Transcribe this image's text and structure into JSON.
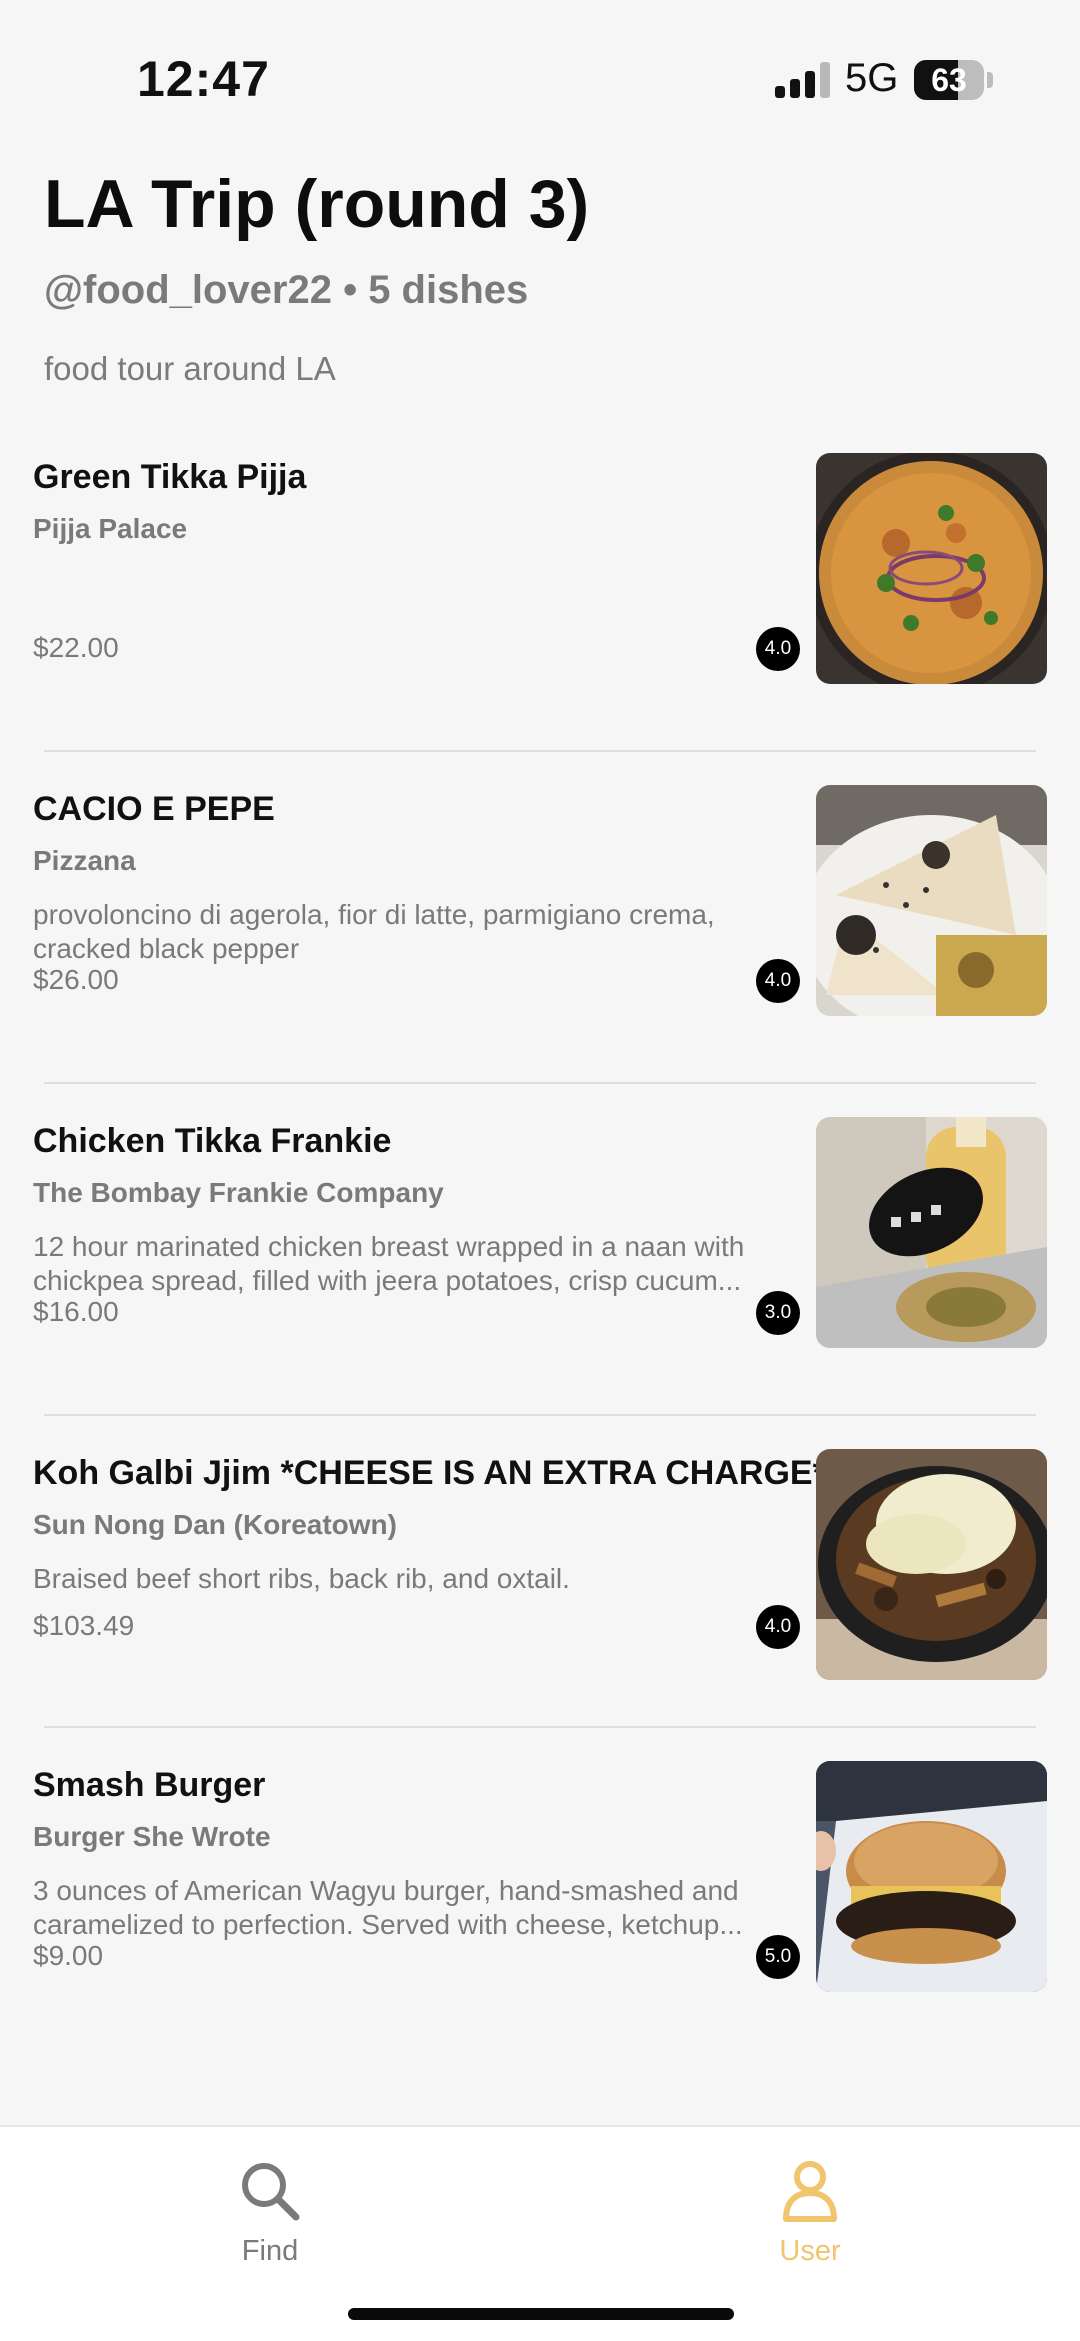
{
  "status_bar": {
    "time": "12:47",
    "network": "5G",
    "battery": "63",
    "battery_level": 0.63
  },
  "header": {
    "title": "LA Trip (round 3)",
    "subtitle": "@food_lover22 • 5 dishes",
    "description": "food tour around LA"
  },
  "dishes": [
    {
      "name": "Green Tikka Pijja",
      "restaurant": "Pijja Palace",
      "description": "",
      "price": "$22.00",
      "rating": "4.0",
      "photo": "pizza-photo"
    },
    {
      "name": "CACIO E PEPE",
      "restaurant": "Pizzana",
      "description": "provoloncino di agerola, fior di latte, parmigiano crema, cracked black pepper",
      "price": "$26.00",
      "rating": "4.0",
      "photo": "cacio-pizza-photo"
    },
    {
      "name": "Chicken Tikka Frankie",
      "restaurant": "The Bombay Frankie Company",
      "description": "12 hour marinated chicken breast wrapped in a naan with chickpea spread, filled with jeera potatoes, crisp cucum...",
      "price": "$16.00",
      "rating": "3.0",
      "photo": "frankie-photo"
    },
    {
      "name": "Koh Galbi Jjim *CHEESE IS AN EXTRA CHARGE*",
      "restaurant": "Sun Nong Dan (Koreatown)",
      "description": "Braised beef short ribs, back rib, and oxtail.",
      "price": "$103.49",
      "rating": "4.0",
      "photo": "galbi-jjim-photo"
    },
    {
      "name": "Smash Burger",
      "restaurant": "Burger She Wrote",
      "description": "3 ounces of American Wagyu burger, hand-smashed and caramelized to perfection. Served with cheese, ketchup...",
      "price": "$9.00",
      "rating": "5.0",
      "photo": "burger-photo"
    }
  ],
  "tabs": {
    "find": {
      "label": "Find",
      "icon": "search-icon"
    },
    "user": {
      "label": "User",
      "icon": "user-icon",
      "active": true
    }
  },
  "colors": {
    "background": "#f6f6f6",
    "active_tab": "#f1c46e",
    "muted_text": "#7a7a7a"
  }
}
